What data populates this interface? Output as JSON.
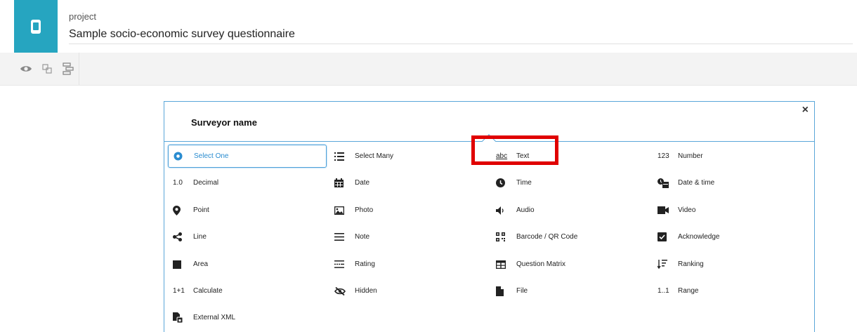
{
  "header": {
    "project_label": "project",
    "project_title": "Sample socio-economic survey questionnaire",
    "logo_icon": "mobile-phone-icon",
    "accent_color": "#26a5c0"
  },
  "toolbar": {
    "buttons": [
      {
        "icon": "eye-icon"
      },
      {
        "icon": "group-icon"
      },
      {
        "icon": "hierarchy-icon"
      }
    ]
  },
  "dialog": {
    "title": "Surveyor name",
    "close_label": "×",
    "border_color": "#5aa7d9"
  },
  "question_types": [
    {
      "label": "Select One",
      "icon": "radio-icon",
      "selected": true
    },
    {
      "label": "Select Many",
      "icon": "list-icon"
    },
    {
      "label": "Text",
      "icon_text": "abc"
    },
    {
      "label": "Number",
      "icon_text": "123"
    },
    {
      "label": "Decimal",
      "icon_text": "1.0"
    },
    {
      "label": "Date",
      "icon": "calendar-icon"
    },
    {
      "label": "Time",
      "icon": "clock-icon"
    },
    {
      "label": "Date & time",
      "icon": "datetime-icon"
    },
    {
      "label": "Point",
      "icon": "map-pin-icon"
    },
    {
      "label": "Photo",
      "icon": "photo-icon"
    },
    {
      "label": "Audio",
      "icon": "speaker-icon"
    },
    {
      "label": "Video",
      "icon": "video-camera-icon"
    },
    {
      "label": "Line",
      "icon": "share-line-icon"
    },
    {
      "label": "Note",
      "icon": "note-lines-icon"
    },
    {
      "label": "Barcode / QR Code",
      "icon": "qr-code-icon"
    },
    {
      "label": "Acknowledge",
      "icon": "checkbox-icon"
    },
    {
      "label": "Area",
      "icon": "square-icon"
    },
    {
      "label": "Rating",
      "icon": "rating-icon"
    },
    {
      "label": "Question Matrix",
      "icon": "table-icon"
    },
    {
      "label": "Ranking",
      "icon": "sort-icon"
    },
    {
      "label": "Calculate",
      "icon_text": "1+1"
    },
    {
      "label": "Hidden",
      "icon": "eye-slash-icon"
    },
    {
      "label": "File",
      "icon": "file-icon"
    },
    {
      "label": "Range",
      "icon_text": "1..1"
    },
    {
      "label": "External XML",
      "icon": "xml-file-icon"
    }
  ],
  "annotation": {
    "highlight_color": "#e00000"
  }
}
